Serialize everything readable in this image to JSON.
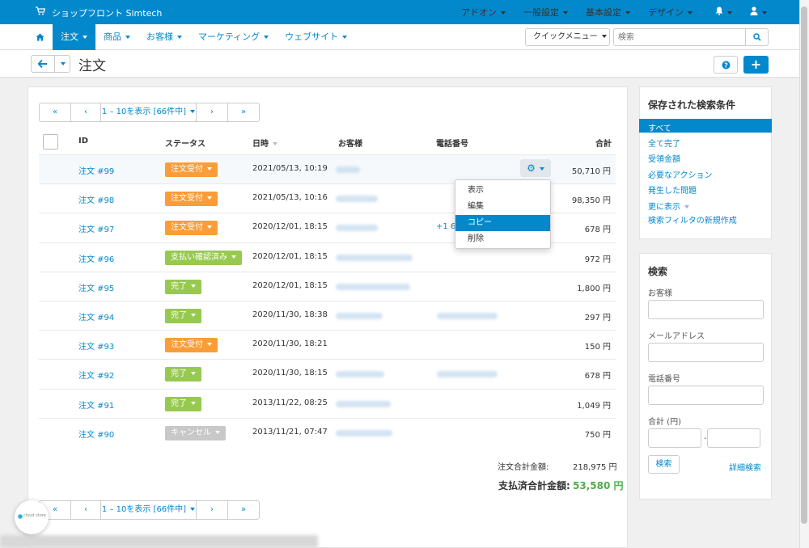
{
  "header": {
    "store_name": "ショップフロント Simtech",
    "nav": [
      "アドオン",
      "一般設定",
      "基本設定",
      "デザイン"
    ]
  },
  "menu": {
    "items": [
      "注文",
      "商品",
      "お客様",
      "マーケティング",
      "ウェブサイト"
    ],
    "active": "注文",
    "quick_menu": "クイックメニュー",
    "search_placeholder": "検索"
  },
  "page": {
    "title": "注文"
  },
  "pager": {
    "first": "«",
    "prev": "‹",
    "label": "1 – 10を表示 [66件中]",
    "next": "›",
    "last": "»"
  },
  "table": {
    "headers": {
      "id": "ID",
      "status": "ステータス",
      "date": "日時",
      "customer": "お客様",
      "phone": "電話番号",
      "total": "合計"
    },
    "rows": [
      {
        "id": "注文 #99",
        "status": "注文受付",
        "status_color": "#f99d39",
        "date": "2021/05/13, 10:19",
        "total": "50,710 円"
      },
      {
        "id": "注文 #98",
        "status": "注文受付",
        "status_color": "#f99d39",
        "date": "2021/05/13, 10:16",
        "total": "98,350 円"
      },
      {
        "id": "注文 #97",
        "status": "注文受付",
        "status_color": "#f99d39",
        "date": "2020/12/01, 18:15",
        "phone": "+1 64",
        "total": "678 円"
      },
      {
        "id": "注文 #96",
        "status": "支払い確認済み",
        "status_color": "#97c950",
        "date": "2020/12/01, 18:15",
        "total": "972 円"
      },
      {
        "id": "注文 #95",
        "status": "完了",
        "status_color": "#97c950",
        "date": "2020/12/01, 18:15",
        "total": "1,800 円"
      },
      {
        "id": "注文 #94",
        "status": "完了",
        "status_color": "#97c950",
        "date": "2020/11/30, 18:38",
        "total": "297 円"
      },
      {
        "id": "注文 #93",
        "status": "注文受付",
        "status_color": "#f99d39",
        "date": "2020/11/30, 18:21",
        "total": "150 円"
      },
      {
        "id": "注文 #92",
        "status": "完了",
        "status_color": "#97c950",
        "date": "2020/11/30, 18:15",
        "total": "678 円"
      },
      {
        "id": "注文 #91",
        "status": "完了",
        "status_color": "#97c950",
        "date": "2013/11/22, 08:25",
        "total": "1,049 円"
      },
      {
        "id": "注文 #90",
        "status": "キャンセル",
        "status_color": "#c8c8c8",
        "date": "2013/11/21, 07:47",
        "total": "750 円"
      }
    ]
  },
  "row_menu": {
    "items": [
      "表示",
      "編集",
      "コピー",
      "削除"
    ],
    "active": "コピー"
  },
  "totals": {
    "order_total_label": "注文合計金額:",
    "order_total_value": "218,975 円",
    "paid_total_label": "支払済合計金額:",
    "paid_total_value": "53,580 円"
  },
  "saved_searches": {
    "title": "保存された検索条件",
    "items": [
      "すべて",
      "全て完了",
      "受領金額",
      "必要なアクション",
      "発生した問題"
    ],
    "active": "すべて",
    "more": "更に表示",
    "new_filter": "検索フィルタの新規作成"
  },
  "search_panel": {
    "title": "検索",
    "customer_label": "お客様",
    "email_label": "メールアドレス",
    "phone_label": "電話番号",
    "total_label": "合計 (円)",
    "range_sep": "-",
    "search_button": "検索",
    "advanced_link": "詳細検索"
  },
  "badge_logo": {
    "text": "cloud store"
  },
  "colors": {
    "primary": "#0388cc",
    "orange": "#f99d39",
    "green": "#97c950",
    "paid_total": "#4cae4c"
  }
}
